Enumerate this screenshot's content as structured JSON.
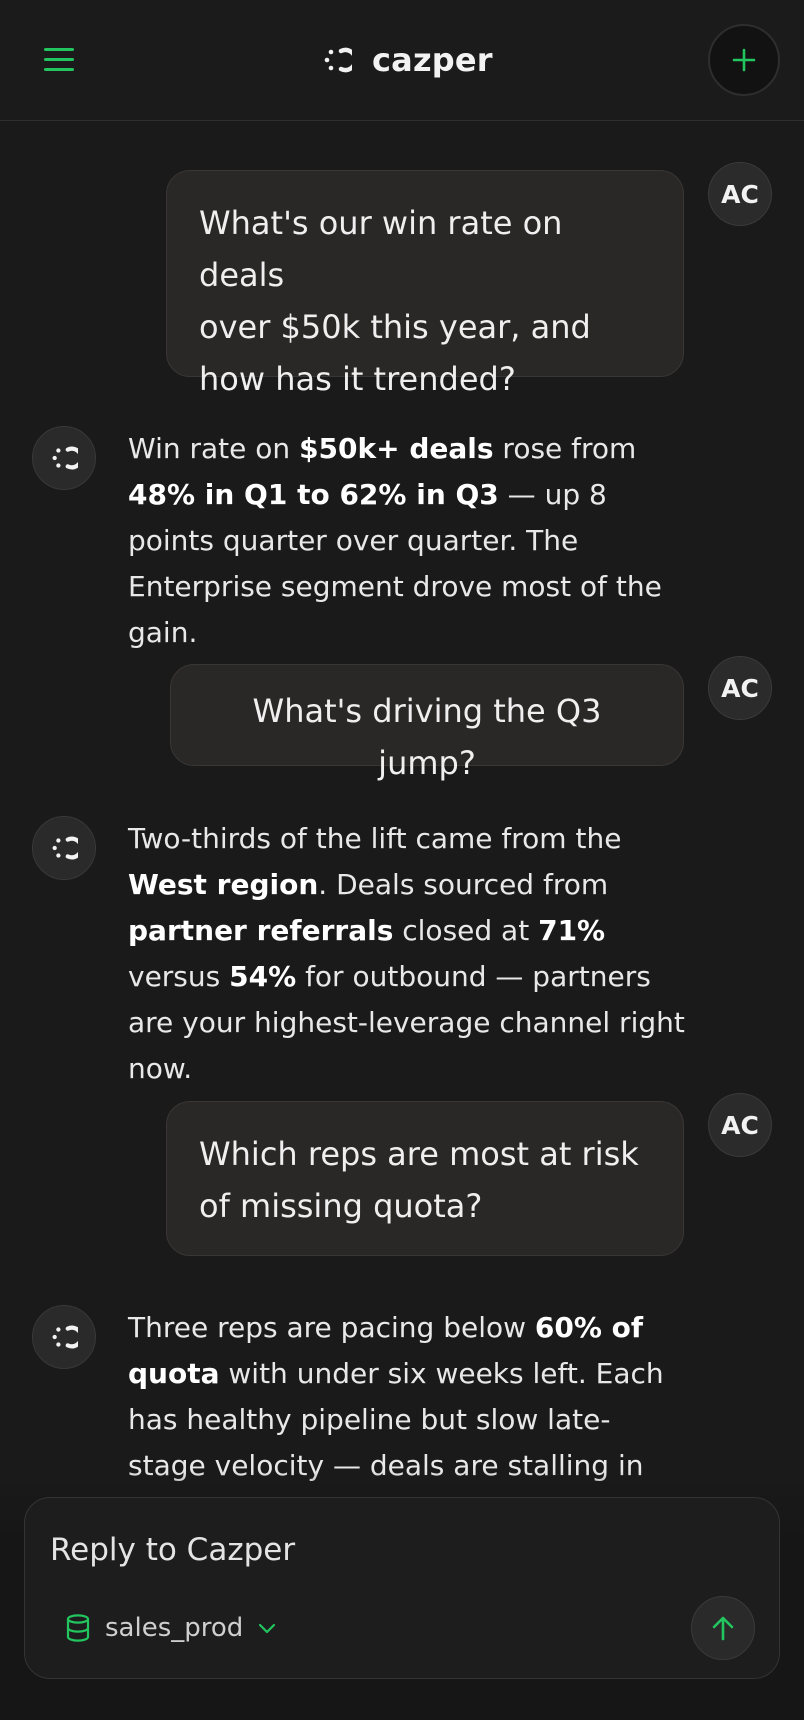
{
  "app": {
    "brand_name": "cazper",
    "accent_color": "#22c55e"
  },
  "header": {
    "menu_icon": "hamburger-menu-icon",
    "new_chat_icon": "plus-icon"
  },
  "conversation": {
    "user_initials": "AC",
    "messages": [
      {
        "role": "user",
        "lines": [
          "What's our win rate on deals",
          "over $50k this year, and",
          "how has it trended?"
        ]
      },
      {
        "role": "assistant",
        "segments": [
          {
            "t": "Win rate on "
          },
          {
            "t": "$50k+ deals",
            "b": true
          },
          {
            "t": " rose from "
          },
          {
            "t": "48% in Q1 to 62% in Q3",
            "b": true
          },
          {
            "t": " — up 8 points quarter over quarter. The Enterprise segment drove most of the gain."
          }
        ]
      },
      {
        "role": "user",
        "lines": [
          "What's driving the Q3 jump?"
        ]
      },
      {
        "role": "assistant",
        "segments": [
          {
            "t": "Two-thirds of the lift came from the "
          },
          {
            "t": "West region",
            "b": true
          },
          {
            "t": ". Deals sourced from "
          },
          {
            "t": "partner referrals",
            "b": true
          },
          {
            "t": " closed at "
          },
          {
            "t": "71%",
            "b": true
          },
          {
            "t": " versus "
          },
          {
            "t": "54%",
            "b": true
          },
          {
            "t": " for outbound — partners are your highest-leverage channel right now."
          }
        ]
      },
      {
        "role": "user",
        "lines": [
          "Which reps are most at risk",
          "of missing quota?"
        ]
      },
      {
        "role": "assistant",
        "segments": [
          {
            "t": "Three reps are pacing below "
          },
          {
            "t": "60% of quota",
            "b": true
          },
          {
            "t": " with under six weeks left. Each has healthy pipeline but slow late-stage velocity — deals are stalling in"
          }
        ]
      }
    ]
  },
  "composer": {
    "placeholder": "Reply to Cazper",
    "database": {
      "label": "sales_prod",
      "icon": "database-icon",
      "chevron_icon": "chevron-down-icon"
    },
    "send_icon": "arrow-up-icon"
  }
}
